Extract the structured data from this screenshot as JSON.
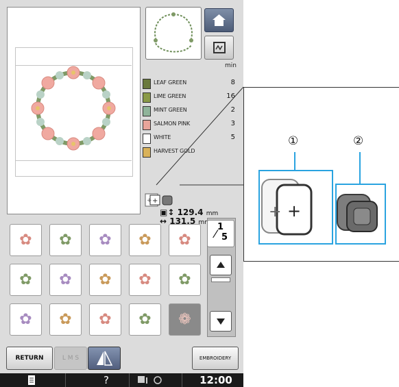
{
  "header": {
    "home_icon": "home-icon",
    "sew_icon": "sewing-frame-icon"
  },
  "colors_list": {
    "min_label": "min",
    "items": [
      {
        "name": "LEAF GREEN",
        "min": "8",
        "hex": "#6a7a3c"
      },
      {
        "name": "LIME GREEN",
        "min": "16",
        "hex": "#8a9a48"
      },
      {
        "name": "MINT GREEN",
        "min": "2",
        "hex": "#8fb49a"
      },
      {
        "name": "SALMON PINK",
        "min": "3",
        "hex": "#e8a49a"
      },
      {
        "name": "WHITE",
        "min": "5",
        "hex": "#ffffff"
      },
      {
        "name": "HARVEST GOLD",
        "min": "",
        "hex": "#d9b25a"
      }
    ]
  },
  "size": {
    "height": "129.4",
    "width": "131.5",
    "unit": "mm"
  },
  "pager": {
    "numerator": "1",
    "denominator": "5"
  },
  "grid_icons": [
    "floral-motif-icon",
    "floral-corner-icon",
    "floral-sprig-icon",
    "floral-swirl-icon",
    "floral-bouquet-icon",
    "floral-spray-icon",
    "floral-border-icon",
    "floral-band-icon",
    "floral-garland-icon",
    "floral-corner2-icon",
    "floral-heart-icon",
    "floral-vine-icon",
    "floral-vase-icon",
    "floral-scroll-icon",
    "wreath-icon"
  ],
  "toolbar": {
    "return_label": "RETURN",
    "lms_label": "L M S",
    "embroidery_label": "EMBROIDERY"
  },
  "status": {
    "help": "?",
    "clock": "12:00"
  },
  "callouts": {
    "one": "①",
    "two": "②"
  },
  "accent": "#29a3e0"
}
